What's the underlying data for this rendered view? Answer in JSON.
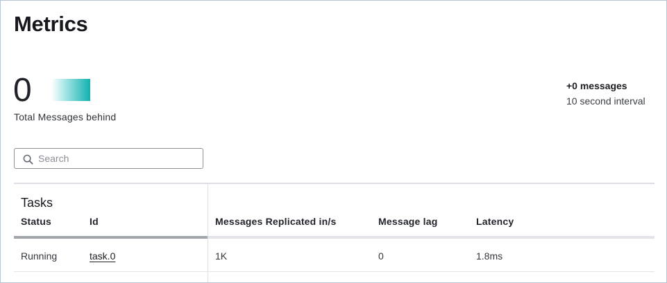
{
  "page": {
    "title": "Metrics"
  },
  "summary": {
    "total_behind_value": "0",
    "total_behind_label": "Total Messages behind",
    "delta_messages": "+0 messages",
    "interval_label": "10 second interval"
  },
  "colors": {
    "accent_teal": "#16b3b3",
    "accent_teal_light": "#e6f8f8"
  },
  "search": {
    "placeholder": "Search",
    "value": "",
    "icon": "search-icon"
  },
  "tasks": {
    "title": "Tasks",
    "columns": [
      "Status",
      "Id",
      "Messages Replicated in/s",
      "Message lag",
      "Latency"
    ],
    "rows": [
      {
        "status": "Running",
        "id": "task.0",
        "replicated": "1K",
        "lag": "0",
        "latency": "1.8ms"
      }
    ]
  }
}
